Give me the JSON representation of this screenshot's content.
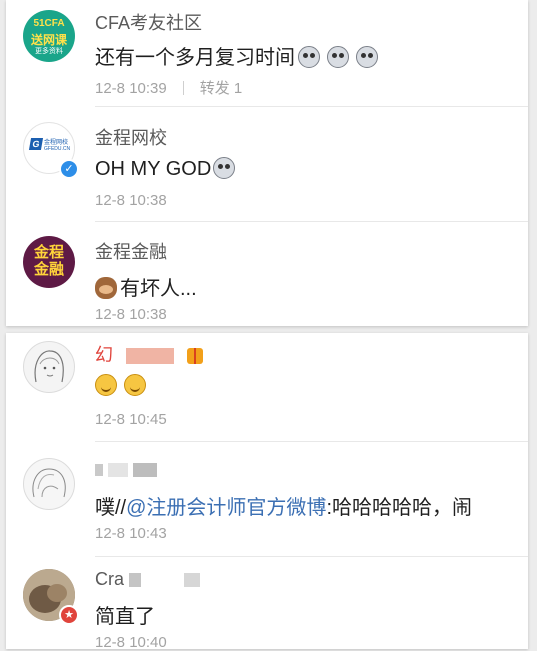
{
  "posts": [
    {
      "avatar_text": [
        "51CFA",
        "送网课",
        "更多资料"
      ],
      "name": "CFA考友社区",
      "text": "还有一个多月复习时间",
      "emojis": [
        "dog-face",
        "dog-face",
        "dog-face"
      ],
      "time": "12-8 10:39",
      "repost": "转发 1"
    },
    {
      "avatar_text": [
        "金程网校",
        "GFEDU.CN"
      ],
      "name": "金程网校",
      "text": "OH MY GOD",
      "emojis": [
        "dog-face"
      ],
      "time": "12-8 10:38",
      "verified": true
    },
    {
      "avatar_text": [
        "金程",
        "金融"
      ],
      "name": "金程金融",
      "text": "有坏人...",
      "emojis": [
        "monkey-face"
      ],
      "time": "12-8 10:38"
    },
    {
      "name": "幻",
      "text": "",
      "emojis": [
        "smile-face",
        "smile-face"
      ],
      "time": "12-8 10:45"
    },
    {
      "name": "",
      "text_prefix": "噗//",
      "mention": "@注册会计师官方微博",
      "text_suffix": ":哈哈哈哈哈，闹",
      "time": "12-8 10:43"
    },
    {
      "name": "Cra",
      "text": "简直了",
      "time": "12-8 10:40"
    }
  ],
  "colors": {
    "background": "#ececec",
    "card": "#ffffff",
    "name": "#5a5a5a",
    "text": "#1f1f1f",
    "meta": "#a3a3a3",
    "mention": "#3b6fb3",
    "cfa_avatar": "#1aa58a",
    "gfedu_blue": "#1c5fb0",
    "jincheng_avatar": "#5e1a45",
    "verified_badge": "#2d8ee8",
    "vip_badge": "#e0443c"
  }
}
